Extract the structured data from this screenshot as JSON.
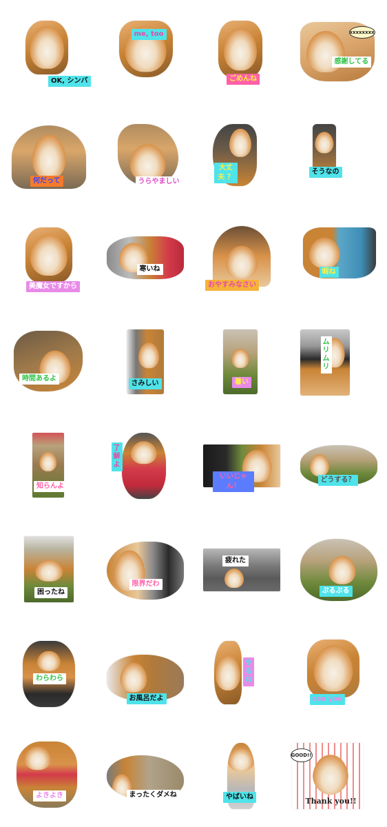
{
  "stickers": [
    {
      "id": 1,
      "label": "OK, シンバ",
      "label_bg": "#4fe3ea",
      "label_fg": "#111111"
    },
    {
      "id": 2,
      "label": "me, too",
      "label_bg": "#4fe3ea",
      "label_fg": "#e64aa8"
    },
    {
      "id": 3,
      "label": "ごめんね",
      "label_bg": "#ff5fa8",
      "label_fg": "#ffee44"
    },
    {
      "id": 4,
      "label": "感謝してる",
      "label_bg": "#ffffff",
      "label_fg": "#33c24a",
      "bubble": "xxxxxxxx"
    },
    {
      "id": 5,
      "label": "何だって",
      "label_bg": "#f47a2c",
      "label_fg": "#3a46ff"
    },
    {
      "id": 6,
      "label": "うらやましい",
      "label_bg": "#ffffff",
      "label_fg": "#e04cc8"
    },
    {
      "id": 7,
      "label": "大丈夫 ？",
      "label_bg": "#4fe3ea",
      "label_fg": "#ffee44"
    },
    {
      "id": 8,
      "label": "そうなの",
      "label_bg": "#4fe3ea",
      "label_fg": "#111111"
    },
    {
      "id": 9,
      "label": "美魔女ですから",
      "label_bg": "#e88ae8",
      "label_fg": "#ffffff"
    },
    {
      "id": 10,
      "label": "寒いね",
      "label_bg": "#ffffff",
      "label_fg": "#111111"
    },
    {
      "id": 11,
      "label": "おやすみなさい",
      "label_bg": "#f5b33a",
      "label_fg": "#e64aa8"
    },
    {
      "id": 12,
      "label": "暇ね",
      "label_bg": "#4fe3ea",
      "label_fg": "#ffee44"
    },
    {
      "id": 13,
      "label": "時間あるよ",
      "label_bg": "#ffffff",
      "label_fg": "#33c24a"
    },
    {
      "id": 14,
      "label": "さみしい",
      "label_bg": "#4fe3ea",
      "label_fg": "#111111"
    },
    {
      "id": 15,
      "label": "暑い",
      "label_bg": "#e88ae8",
      "label_fg": "#ffee44"
    },
    {
      "id": 16,
      "label": "ムリムリ",
      "label_bg": "#ffffff",
      "label_fg": "#33c24a"
    },
    {
      "id": 17,
      "label": "知らんよ",
      "label_bg": "#ffffff",
      "label_fg": "#ff5fa8"
    },
    {
      "id": 18,
      "label": "了解よ",
      "label_bg": "#4fe3ea",
      "label_fg": "#e64aa8"
    },
    {
      "id": 19,
      "label": "いいじゃん！",
      "label_bg": "#5c7cff",
      "label_fg": "#ff5fa8"
    },
    {
      "id": 20,
      "label": "どうする？",
      "label_bg": "#4fe3ea",
      "label_fg": "#555555"
    },
    {
      "id": 21,
      "label": "困ったね",
      "label_bg": "#ffffff",
      "label_fg": "#111111"
    },
    {
      "id": 22,
      "label": "限界だわ",
      "label_bg": "#ffffff",
      "label_fg": "#ff5fa8"
    },
    {
      "id": 23,
      "label": "疲れた",
      "label_bg": "#ffffff",
      "label_fg": "#111111"
    },
    {
      "id": 24,
      "label": "ぷるぷる",
      "label_bg": "#4fe3ea",
      "label_fg": "#ffffff"
    },
    {
      "id": 25,
      "label": "わらわら",
      "label_bg": "#ffffff",
      "label_fg": "#33c24a"
    },
    {
      "id": 26,
      "label": "お風呂だよ",
      "label_bg": "#4fe3ea",
      "label_fg": "#111111"
    },
    {
      "id": 27,
      "label": "やるね",
      "label_bg": "#e88ae8",
      "label_fg": "#4fe3ea"
    },
    {
      "id": 28,
      "label": "see you",
      "label_bg": "#4fe3ea",
      "label_fg": "#e88ae8"
    },
    {
      "id": 29,
      "label": "よきよき",
      "label_bg": "#ffffff",
      "label_fg": "#e88ae8"
    },
    {
      "id": 30,
      "label": "まったくダメね",
      "label_bg": "#ffffff",
      "label_fg": "#111111"
    },
    {
      "id": 31,
      "label": "やばいね",
      "label_bg": "#4fe3ea",
      "label_fg": "#111111"
    },
    {
      "id": 32,
      "label": "Thank you!!",
      "label_bg": "#ffffff",
      "label_fg": "#222222",
      "bubble": "GOOD!!"
    }
  ]
}
